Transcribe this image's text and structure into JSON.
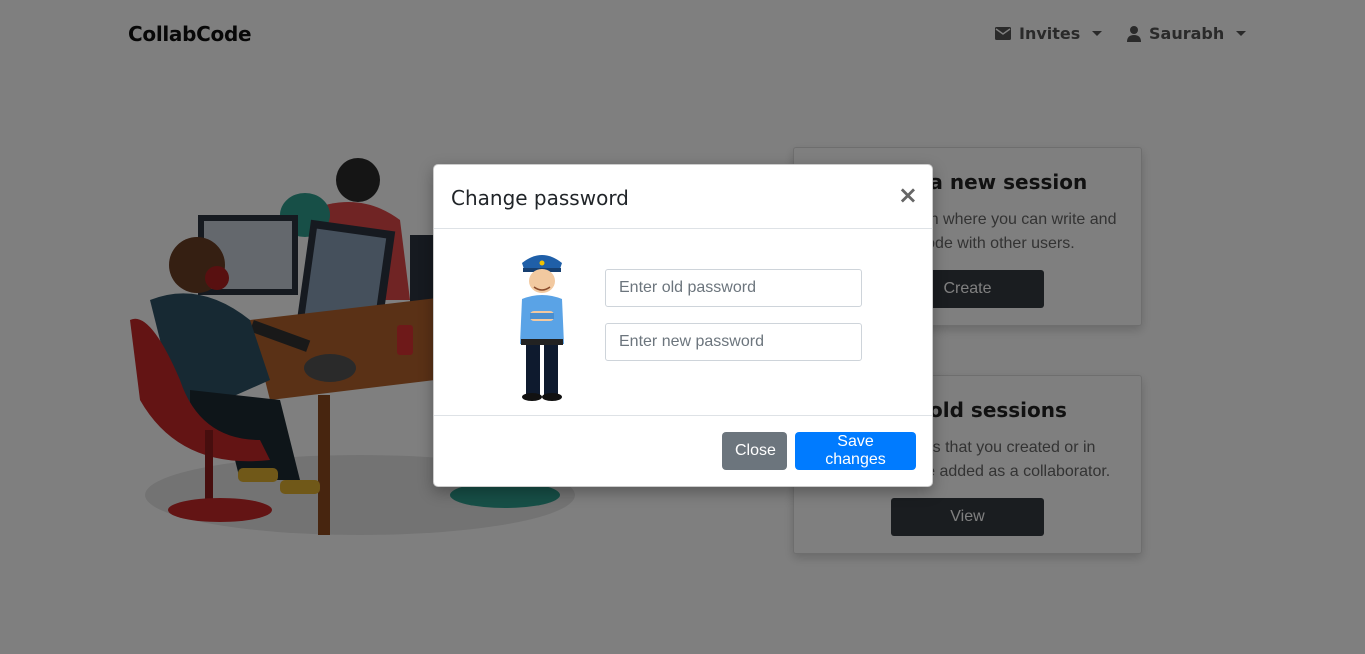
{
  "navbar": {
    "brand": "CollabCode",
    "invites_label": "Invites",
    "user_label": "Saurabh"
  },
  "cards": {
    "create": {
      "title": "Create a new session",
      "text": "Create a session where you can write and run any code with other users.",
      "button": "Create"
    },
    "view": {
      "title": "View old sessions",
      "text": "View sessions that you created or in which you were added as a collaborator.",
      "button": "View"
    }
  },
  "modal": {
    "title": "Change password",
    "close_symbol": "×",
    "old_password_placeholder": "Enter old password",
    "new_password_placeholder": "Enter new password",
    "close_button": "Close",
    "save_button": "Save changes"
  },
  "colors": {
    "primary": "#007bff",
    "secondary": "#6c757d",
    "dark": "#343a40"
  }
}
